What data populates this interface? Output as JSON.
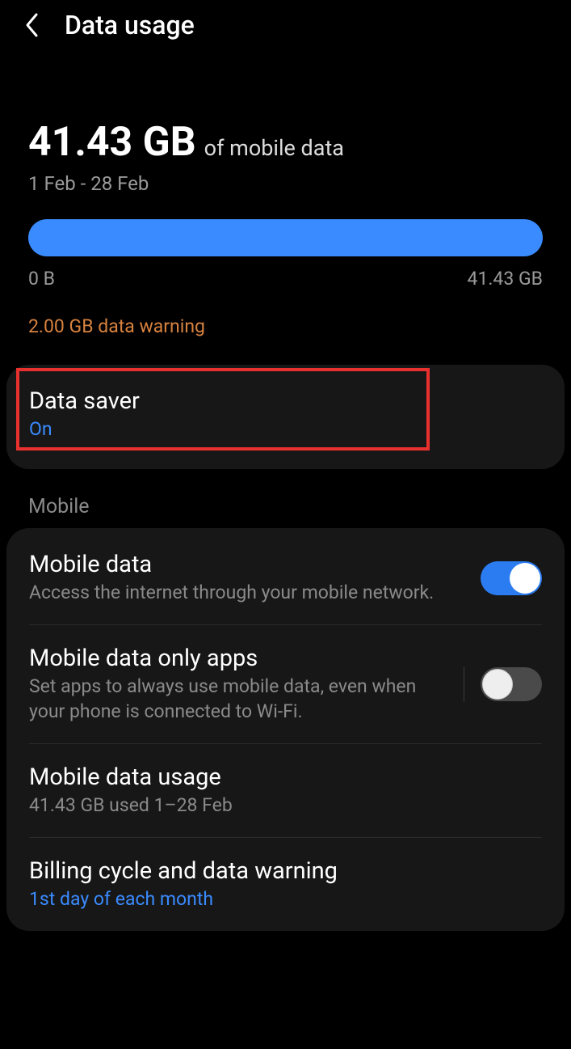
{
  "header": {
    "title": "Data usage"
  },
  "usage": {
    "amount": "41.43 GB",
    "suffix": "of mobile data",
    "period": "1 Feb - 28 Feb",
    "min_label": "0 B",
    "max_label": "41.43 GB",
    "warning": "2.00 GB data warning"
  },
  "data_saver": {
    "title": "Data saver",
    "status": "On"
  },
  "section_mobile": "Mobile",
  "mobile_data": {
    "title": "Mobile data",
    "sub": "Access the internet through your mobile network.",
    "on": true
  },
  "mobile_only_apps": {
    "title": "Mobile data only apps",
    "sub": "Set apps to always use mobile data, even when your phone is connected to Wi-Fi.",
    "on": false
  },
  "mobile_usage": {
    "title": "Mobile data usage",
    "sub": "41.43 GB used 1–28 Feb"
  },
  "billing": {
    "title": "Billing cycle and data warning",
    "sub": "1st day of each month"
  }
}
